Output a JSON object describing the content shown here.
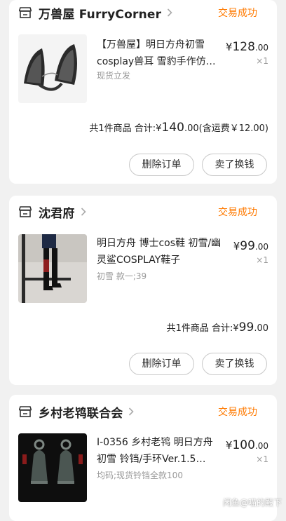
{
  "orders": [
    {
      "shop": "万兽屋 FurryCorner",
      "status": "交易成功",
      "title": "【万兽屋】明日方舟初雪cosplay兽耳 雪豹手作仿…",
      "sku": "现货立发",
      "price_symbol": "¥",
      "price_int": "128",
      "price_dec": ".00",
      "qty": "×1",
      "summary_prefix": "共1件商品 合计:",
      "summary_symbol": "¥",
      "summary_int": "140",
      "summary_dec": ".00",
      "summary_suffix": "(含运费￥12.00)",
      "btn_delete": "删除订单",
      "btn_resell": "卖了换钱",
      "image": "furry-ears-photo"
    },
    {
      "shop": "沈君府",
      "status": "交易成功",
      "title": "明日方舟 博士cos鞋 初雪/幽灵鲨COSPLAY鞋子",
      "sku": "初雪 款一;39",
      "price_symbol": "¥",
      "price_int": "99",
      "price_dec": ".00",
      "qty": "×1",
      "summary_prefix": "共1件商品 合计:",
      "summary_symbol": "¥",
      "summary_int": "99",
      "summary_dec": ".00",
      "summary_suffix": "",
      "btn_delete": "删除订单",
      "btn_resell": "卖了换钱",
      "image": "boots-photo"
    },
    {
      "shop": "乡村老鸨联合会",
      "status": "交易成功",
      "title": "I-0356 乡村老鸨 明日方舟 初雪 铃铛/手环Ver.1.5…",
      "sku": "均码;现货铃铛全款100",
      "price_symbol": "¥",
      "price_int": "100",
      "price_dec": ".00",
      "qty": "×1",
      "image": "bells-photo"
    }
  ],
  "watermark": "闲鱼@喵的殿下"
}
